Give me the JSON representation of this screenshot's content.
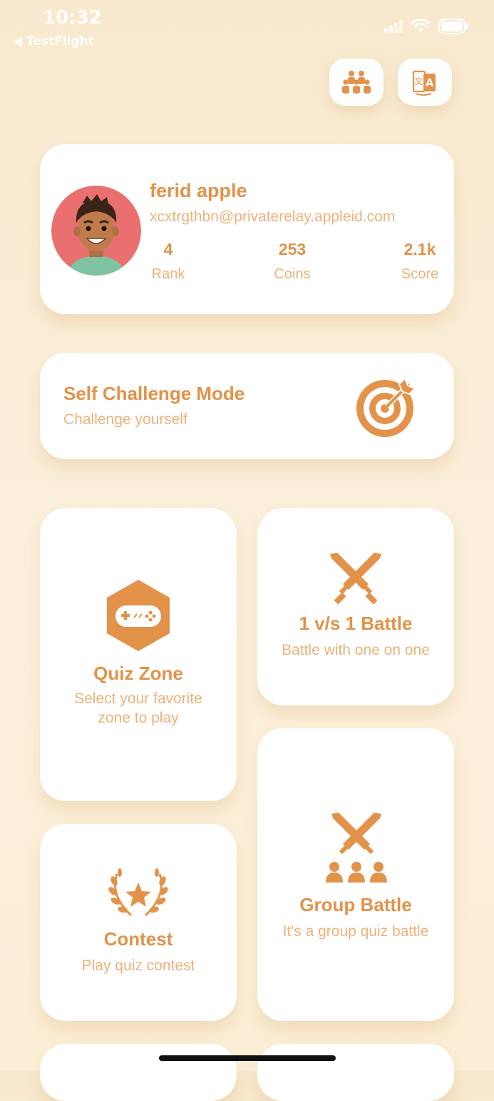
{
  "status_bar": {
    "time": "10:32",
    "back_app": "◀ TestFlight"
  },
  "toolbar": {
    "leaderboard_icon": "group-users-icon",
    "language_icon": "translate-icon"
  },
  "profile": {
    "name": "ferid apple",
    "email": "xcxtrgthbn@privaterelay.appleid.com",
    "stats": [
      {
        "value": "4",
        "label": "Rank"
      },
      {
        "value": "253",
        "label": "Coins"
      },
      {
        "value": "2.1k",
        "label": "Score"
      }
    ]
  },
  "self_challenge": {
    "title": "Self Challenge Mode",
    "subtitle": "Challenge yourself"
  },
  "tiles": {
    "quiz_zone": {
      "title": "Quiz Zone",
      "subtitle_line1": "Select your favorite",
      "subtitle_line2": "zone to play"
    },
    "battle": {
      "title": "1 v/s 1 Battle",
      "subtitle": "Battle with one on one"
    },
    "contest": {
      "title": "Contest",
      "subtitle": "Play quiz contest"
    },
    "group_battle": {
      "title": "Group Battle",
      "subtitle": "It's a group quiz battle"
    }
  },
  "colors": {
    "accent": "#e3924a",
    "accent_light": "#ecb27a",
    "background": "#f8e9ce"
  }
}
